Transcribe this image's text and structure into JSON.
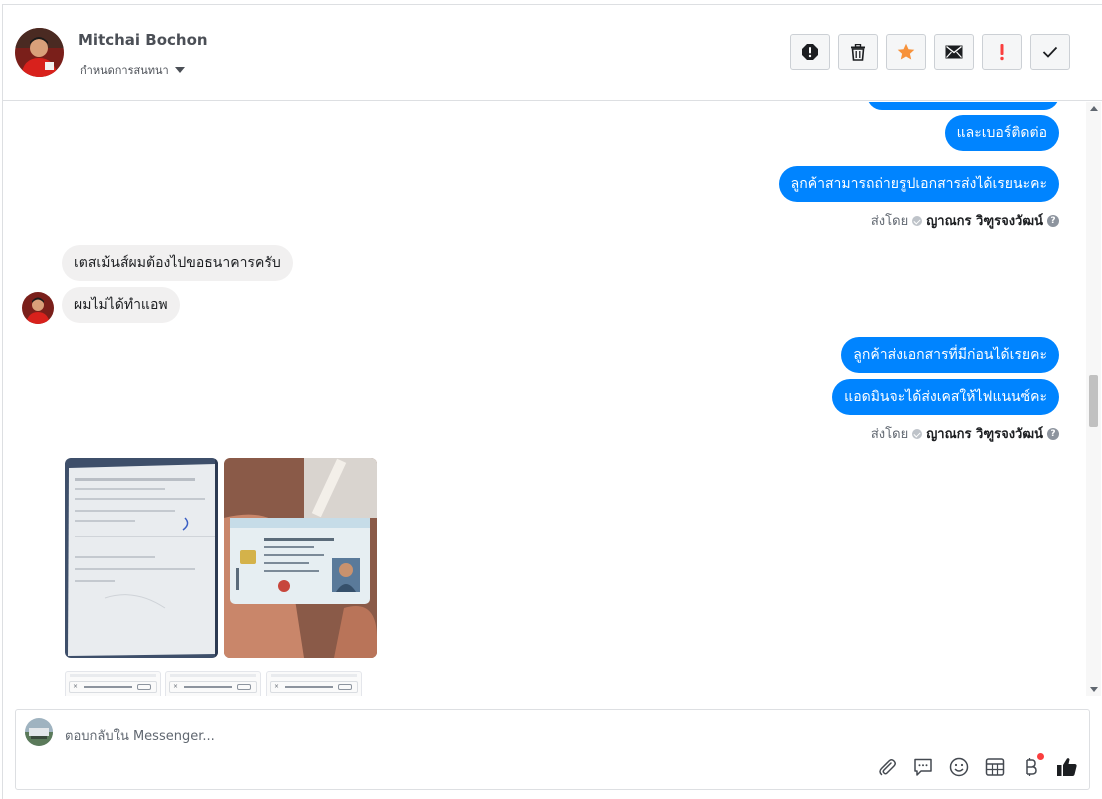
{
  "header": {
    "contact_name": "Mitchai Bochon",
    "conversation_label": "กำหนดการสนทนา",
    "toolbar": [
      {
        "name": "report-button",
        "icon": "exclamation-circle-icon"
      },
      {
        "name": "delete-button",
        "icon": "trash-icon"
      },
      {
        "name": "star-button",
        "icon": "star-icon"
      },
      {
        "name": "mark-unread-button",
        "icon": "envelope-icon"
      },
      {
        "name": "important-button",
        "icon": "exclamation-icon"
      },
      {
        "name": "done-button",
        "icon": "checkmark-icon"
      }
    ]
  },
  "messages": {
    "out_1": "และเบอร์ติดต่อ",
    "out_2": "ลูกค้าสามารถถ่ายรูปเอกสารส่งได้เรยนะคะ",
    "sent_by_label": "ส่งโดย",
    "sender_name": "ญาณกร วิฑูรจงวัฒน์",
    "help_glyph": "?",
    "in_1": "เตสเม้นส์ผมต้องไปขอธนาคารครับ",
    "in_2": "ผมไม่ได้ทำแอพ",
    "out_3": "ลูกค้าส่งเอกสารที่มีก่อนได้เรยคะ",
    "out_4": "แอดมินจะได้ส่งเคสให้ไฟแนนซ์คะ"
  },
  "composer": {
    "placeholder": "ตอบกลับใน Messenger...",
    "tools": [
      "paperclip-icon",
      "speech-bubble-icon",
      "smiley-icon",
      "table-icon",
      "bitcoin-icon",
      "thumbs-up-icon"
    ]
  },
  "colors": {
    "outgoing": "#0084ff",
    "incoming": "#f1f0f0",
    "star": "#f7923b",
    "important": "#fa3e3e"
  }
}
